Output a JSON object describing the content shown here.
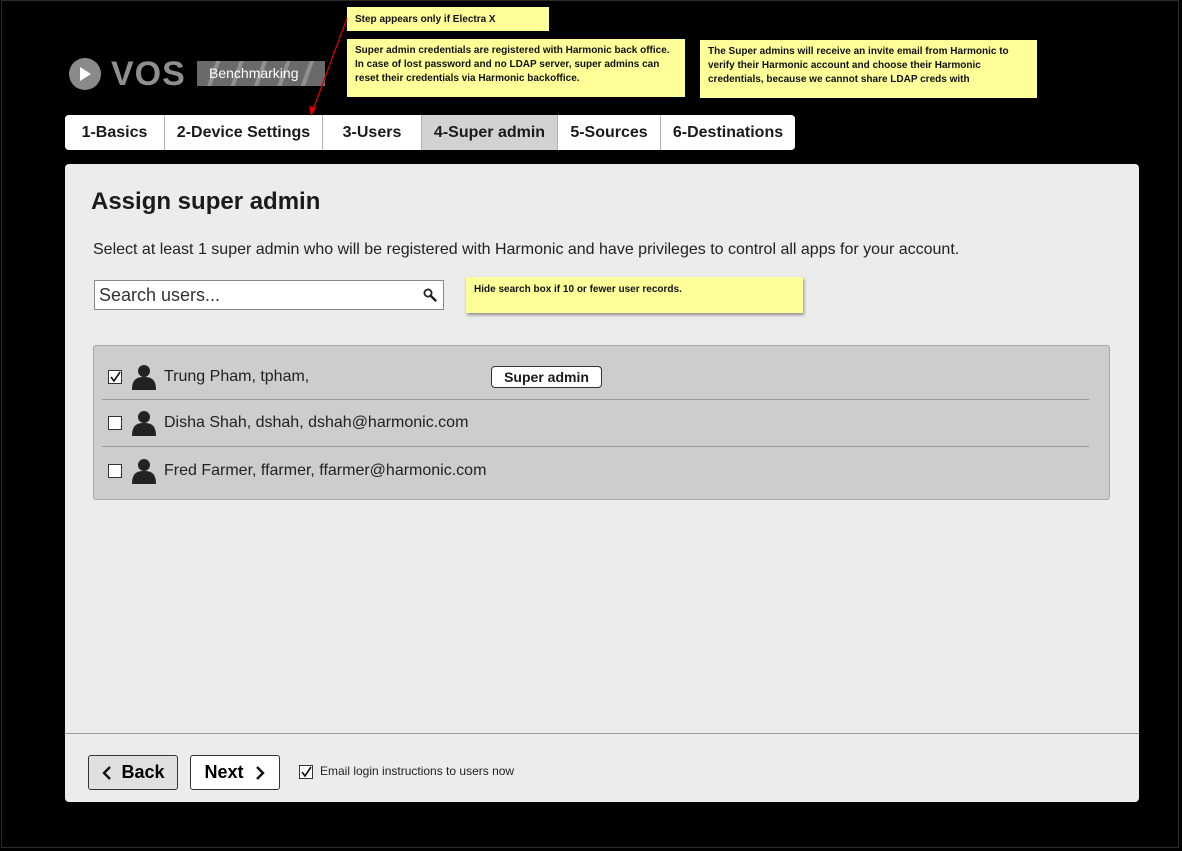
{
  "logo": {
    "name": "VOS",
    "subtitle": "Benchmarking"
  },
  "notes": {
    "step": "Step appears only if Electra X",
    "credentials": "Super admin credentials are registered with Harmonic back office. In case of lost password and no LDAP server, super admins can reset their credentials via Harmonic backoffice.",
    "invite": "The Super admins will receive an invite email from Harmonic to verify their Harmonic account and choose their Harmonic credentials, because we cannot share LDAP creds with",
    "search": "Hide search box if 10 or fewer user records."
  },
  "tabs": [
    {
      "label": "1-Basics",
      "active": false
    },
    {
      "label": "2-Device Settings",
      "active": false
    },
    {
      "label": "3-Users",
      "active": false
    },
    {
      "label": "4-Super admin",
      "active": true
    },
    {
      "label": "5-Sources",
      "active": false
    },
    {
      "label": "6-Destinations",
      "active": false
    }
  ],
  "main": {
    "title": "Assign super admin",
    "description": "Select at least 1 super admin who will be registered with Harmonic and have privileges to control all apps for your account.",
    "search_placeholder": "Search users...",
    "users": [
      {
        "label": "Trung Pham, tpham,",
        "checked": true,
        "badge": "Super admin"
      },
      {
        "label": "Disha Shah, dshah, dshah@harmonic.com",
        "checked": false,
        "badge": ""
      },
      {
        "label": "Fred Farmer, ffarmer, ffarmer@harmonic.com",
        "checked": false,
        "badge": ""
      }
    ]
  },
  "footer": {
    "back_label": "Back",
    "next_label": "Next",
    "email_label": "Email login instructions to users now",
    "email_checked": true
  },
  "colors": {
    "background": "#000000",
    "panel": "#ececec",
    "note": "#ffff99",
    "active_tab": "#d2d2d2",
    "list": "#cdcdcd",
    "arrow": "#e00000"
  }
}
